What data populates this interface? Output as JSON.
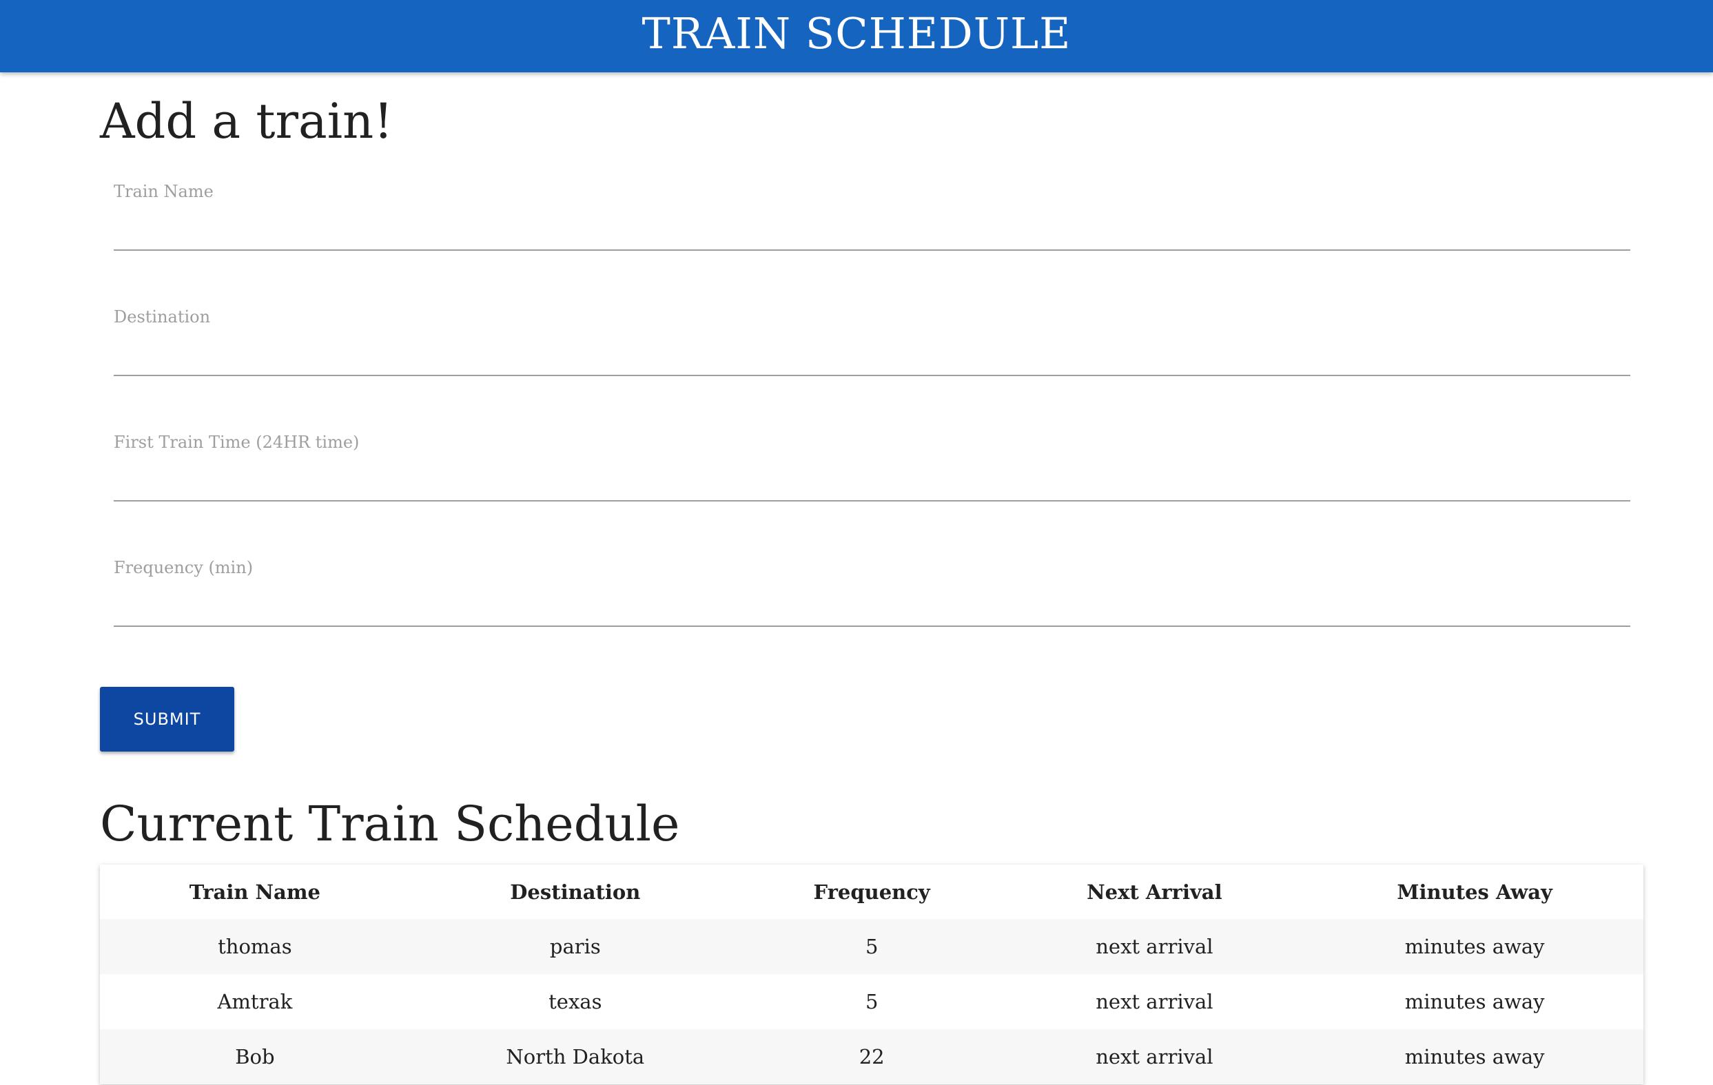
{
  "header": {
    "title": "TRAIN SCHEDULE"
  },
  "form": {
    "heading": "Add a train!",
    "fields": [
      {
        "label": "Train Name",
        "value": ""
      },
      {
        "label": "Destination",
        "value": ""
      },
      {
        "label": "First Train Time (24HR time)",
        "value": ""
      },
      {
        "label": "Frequency (min)",
        "value": ""
      }
    ],
    "submit_label": "SUBMIT"
  },
  "schedule": {
    "heading": "Current Train Schedule",
    "columns": [
      "Train Name",
      "Destination",
      "Frequency",
      "Next Arrival",
      "Minutes Away"
    ],
    "rows": [
      [
        "thomas",
        "paris",
        "5",
        "next arrival",
        "minutes away"
      ],
      [
        "Amtrak",
        "texas",
        "5",
        "next arrival",
        "minutes away"
      ],
      [
        "Bob",
        "North Dakota",
        "22",
        "next arrival",
        "minutes away"
      ]
    ]
  },
  "colors": {
    "header_bg": "#1565c0",
    "button_bg": "#0d47a1",
    "label_gray": "#9e9e9e",
    "row_stripe": "#f7f7f7"
  }
}
